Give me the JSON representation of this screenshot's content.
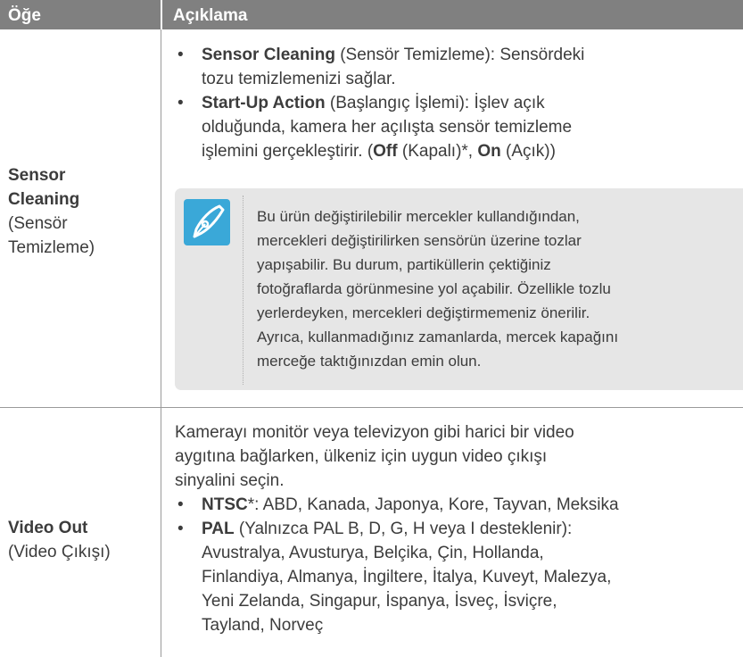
{
  "header": {
    "item": "Öğe",
    "desc": "Açıklama"
  },
  "row1": {
    "item_bold_1": "Sensor",
    "item_bold_2": "Cleaning",
    "item_sub_1": "(Sensör",
    "item_sub_2": "Temizleme)",
    "b1_bold": "Sensor Cleaning",
    "b1_line1_rest": " (Sensör Temizleme): Sensördeki",
    "b1_line2": "tozu temizlemenizi sağlar.",
    "b2_bold": "Start-Up Action",
    "b2_line1_rest": " (Başlangıç İşlemi): İşlev açık",
    "b2_line2": "olduğunda, kamera her açılışta sensör temizleme",
    "b2_line3_pre": "işlemini gerçekleştirir. (",
    "b2_off": "Off",
    "b2_mid": " (Kapalı)*, ",
    "b2_on": "On",
    "b2_end": " (Açık))",
    "note_lines": [
      "Bu ürün değiştirilebilir mercekler kullandığından,",
      "mercekleri değiştirilirken sensörün üzerine tozlar",
      "yapışabilir. Bu durum, partiküllerin çektiğiniz",
      "fotoğraflarda görünmesine yol açabilir. Özellikle tozlu",
      "yerlerdeyken, mercekleri değiştirmemeniz önerilir.",
      "Ayrıca, kullanmadığınız zamanlarda, mercek kapağını",
      "merceğe taktığınızdan emin olun."
    ]
  },
  "row2": {
    "item_bold": "Video Out",
    "item_sub": "(Video Çıkışı)",
    "intro_lines": [
      "Kamerayı monitör veya televizyon gibi harici bir video",
      "aygıtına bağlarken, ülkeniz için uygun video çıkışı",
      "sinyalini seçin."
    ],
    "ntsc_bold": "NTSC",
    "ntsc_rest": "*: ABD, Kanada, Japonya, Kore, Tayvan, Meksika",
    "pal_bold": "PAL",
    "pal_line1_rest": " (Yalnızca PAL B, D, G, H veya I desteklenir):",
    "pal_lines": [
      "Avustralya, Avusturya, Belçika, Çin, Hollanda,",
      "Finlandiya, Almanya, İngiltere, İtalya, Kuveyt, Malezya,",
      "Yeni Zelanda, Singapur, İspanya, İsveç, İsviçre,",
      "Tayland, Norveç"
    ]
  },
  "colors": {
    "header_bg": "#808080",
    "note_bg": "#e6e6e6",
    "icon_bg": "#3aa8d8",
    "text": "#3c3c3c"
  },
  "icons": {
    "note": "pen-nib-icon"
  }
}
